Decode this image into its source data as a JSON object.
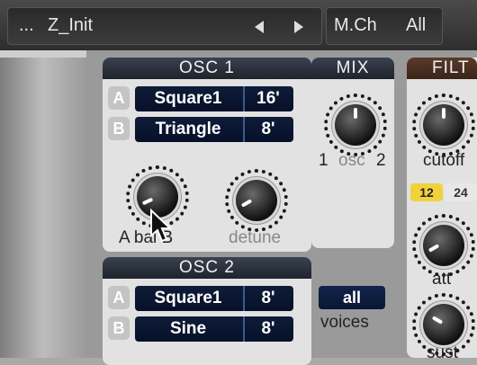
{
  "topbar": {
    "menu_dots": "...",
    "preset_name": "Z_Init",
    "midi_channel_label": "M.Ch",
    "midi_channel_value": "All"
  },
  "osc1": {
    "title": "OSC 1",
    "slot_a": "A",
    "slot_b": "B",
    "wave_a": "Triangle",
    "wave_a_name": "Square1",
    "wave_a_octave": "16'",
    "wave_b_name": "Triangle",
    "wave_b_octave": "8'",
    "knob_balance_label": "A bal B",
    "knob_detune_label": "detune"
  },
  "osc2": {
    "title": "OSC 2",
    "slot_a": "A",
    "slot_b": "B",
    "wave_a_name": "Square1",
    "wave_a_octave": "8'",
    "wave_b_name": "Sine",
    "wave_b_octave": "8'"
  },
  "mix": {
    "title": "MIX",
    "label_left": "1",
    "label_mid": "osc",
    "label_right": "2",
    "voices_button": "all",
    "voices_label": "voices"
  },
  "filter": {
    "title": "FILT",
    "cutoff_label": "cutoff",
    "slope_12": "12",
    "slope_24": "24",
    "att_label": "att",
    "sust_label": "sust"
  },
  "colors": {
    "header_dark": "#1e232b",
    "wave_display": "#06102a",
    "filter_header": "#3a2418",
    "slope_active": "#f2d23a"
  }
}
